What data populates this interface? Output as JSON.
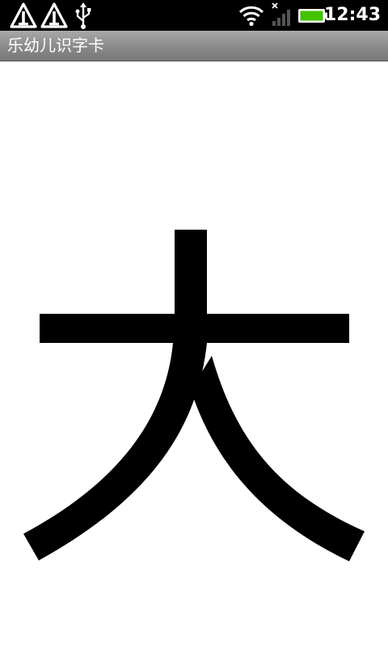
{
  "status_bar": {
    "time": "12:43",
    "icons": [
      "warning-icon",
      "warning-icon",
      "usb-icon",
      "wifi-icon",
      "no-signal-icon",
      "battery-icon"
    ],
    "battery_color": "#44c200"
  },
  "title_bar": {
    "title": "乐幼儿识字卡"
  },
  "card": {
    "character": "大",
    "glyph_color": "#000000"
  }
}
